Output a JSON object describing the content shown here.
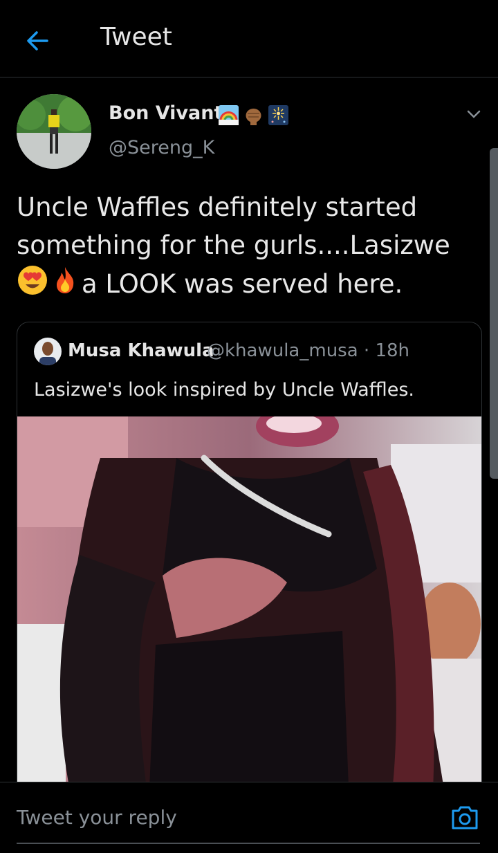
{
  "header": {
    "title": "Tweet"
  },
  "author": {
    "name": "Bon Vivant.",
    "handle": "@Sereng_K",
    "name_emojis": [
      "rainbow-emoji",
      "raised-fist-emoji",
      "fireworks-emoji"
    ]
  },
  "tweet": {
    "line1": "Uncle Waffles definitely started",
    "line2": "something for the gurls....Lasizwe",
    "line3": "a LOOK was served here.",
    "inline_emojis": [
      "heart-eyes-emoji",
      "fire-emoji"
    ]
  },
  "quote": {
    "name": "Musa Khawula",
    "handle_time": "@khawula_musa · 18h",
    "text": "Lasizwe's look inspired by Uncle Waffles."
  },
  "reply": {
    "placeholder": "Tweet your reply"
  },
  "colors": {
    "accent": "#1d9bf0",
    "background": "#000000",
    "muted": "#8a9198"
  }
}
